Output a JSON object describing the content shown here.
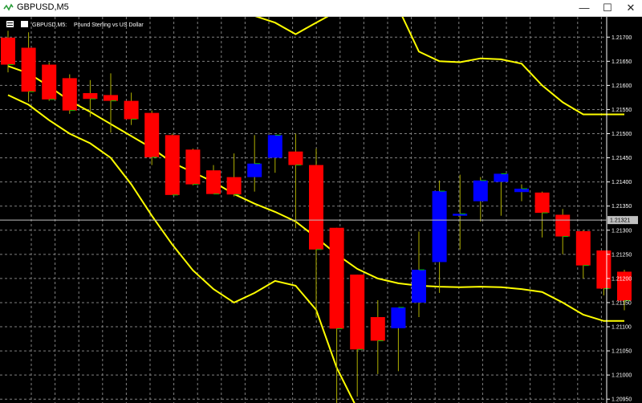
{
  "window": {
    "title": "GBPUSD,M5",
    "minimize_glyph": "—",
    "maximize_glyph": "☐",
    "close_glyph": "✕"
  },
  "chart_header": {
    "symbol_text": "GBPUSD,M5:",
    "description": "Pound Sterling vs US Dollar"
  },
  "colors": {
    "background": "#000000",
    "grid": "#808080",
    "bull": "#0000ff",
    "bear": "#ff0000",
    "bands": "#ffff00",
    "axis_text": "#ffffff",
    "current_price_tag": "#c0c0c0"
  },
  "current_price": "1.21321",
  "chart_data": {
    "type": "candlestick",
    "y_axis_ticks": [
      "1.21700",
      "1.21650",
      "1.21600",
      "1.21550",
      "1.21500",
      "1.21450",
      "1.21400",
      "1.21350",
      "1.21300",
      "1.21250",
      "1.21200",
      "1.21150",
      "1.21100",
      "1.21050",
      "1.21000",
      "1.20950"
    ],
    "ylim": [
      1.20942,
      1.21742
    ],
    "candles": [
      {
        "o": 1.21699,
        "h": 1.21713,
        "l": 1.21627,
        "c": 1.21643
      },
      {
        "o": 1.21678,
        "h": 1.2171,
        "l": 1.21566,
        "c": 1.21587
      },
      {
        "o": 1.21643,
        "h": 1.21648,
        "l": 1.21568,
        "c": 1.21571
      },
      {
        "o": 1.21615,
        "h": 1.21623,
        "l": 1.21541,
        "c": 1.21548
      },
      {
        "o": 1.21584,
        "h": 1.21611,
        "l": 1.21535,
        "c": 1.21572
      },
      {
        "o": 1.2158,
        "h": 1.21625,
        "l": 1.21502,
        "c": 1.21568
      },
      {
        "o": 1.21568,
        "h": 1.21585,
        "l": 1.21518,
        "c": 1.2153
      },
      {
        "o": 1.21543,
        "h": 1.21548,
        "l": 1.21435,
        "c": 1.21451
      },
      {
        "o": 1.21497,
        "h": 1.215,
        "l": 1.21375,
        "c": 1.21373
      },
      {
        "o": 1.21467,
        "h": 1.21469,
        "l": 1.21393,
        "c": 1.21395
      },
      {
        "o": 1.21424,
        "h": 1.21435,
        "l": 1.2138,
        "c": 1.21375
      },
      {
        "o": 1.2141,
        "h": 1.21459,
        "l": 1.2137,
        "c": 1.21374
      },
      {
        "o": 1.2141,
        "h": 1.21497,
        "l": 1.2138,
        "c": 1.21438
      },
      {
        "o": 1.2145,
        "h": 1.21484,
        "l": 1.21419,
        "c": 1.21497
      },
      {
        "o": 1.21463,
        "h": 1.215,
        "l": 1.21304,
        "c": 1.21435
      },
      {
        "o": 1.21435,
        "h": 1.21469,
        "l": 1.2112,
        "c": 1.2126
      },
      {
        "o": 1.21305,
        "h": 1.21305,
        "l": 1.2094,
        "c": 1.21096
      },
      {
        "o": 1.21208,
        "h": 1.21208,
        "l": 1.20955,
        "c": 1.21053
      },
      {
        "o": 1.2112,
        "h": 1.21155,
        "l": 1.21002,
        "c": 1.21071
      },
      {
        "o": 1.21097,
        "h": 1.2112,
        "l": 1.21008,
        "c": 1.2114
      },
      {
        "o": 1.2115,
        "h": 1.21297,
        "l": 1.2112,
        "c": 1.21218
      },
      {
        "o": 1.21234,
        "h": 1.21403,
        "l": 1.2117,
        "c": 1.21381
      },
      {
        "o": 1.2133,
        "h": 1.21415,
        "l": 1.2126,
        "c": 1.21334
      },
      {
        "o": 1.2136,
        "h": 1.2141,
        "l": 1.21318,
        "c": 1.21403
      },
      {
        "o": 1.214,
        "h": 1.21406,
        "l": 1.2133,
        "c": 1.21417
      },
      {
        "o": 1.21379,
        "h": 1.21395,
        "l": 1.2136,
        "c": 1.21386
      },
      {
        "o": 1.21378,
        "h": 1.2138,
        "l": 1.21285,
        "c": 1.21336
      },
      {
        "o": 1.21332,
        "h": 1.21344,
        "l": 1.2125,
        "c": 1.21287
      },
      {
        "o": 1.21298,
        "h": 1.213,
        "l": 1.212,
        "c": 1.21227
      },
      {
        "o": 1.21258,
        "h": 1.21258,
        "l": 1.21165,
        "c": 1.21179
      },
      {
        "o": 1.21214,
        "h": 1.21218,
        "l": 1.21134,
        "c": 1.21154
      }
    ],
    "bollinger": {
      "upper": [
        null,
        null,
        null,
        null,
        null,
        null,
        null,
        null,
        null,
        null,
        null,
        null,
        1.21744,
        1.2173,
        1.21706,
        1.2173,
        1.21753,
        1.2179,
        1.2181,
        1.2176,
        1.2167,
        1.2165,
        1.21648,
        1.21656,
        1.21654,
        1.21645,
        1.216,
        1.21565,
        1.2154,
        1.2154,
        1.2154
      ],
      "middle": [
        1.2164,
        1.21625,
        1.21598,
        1.21568,
        1.21545,
        1.2152,
        1.21495,
        1.2147,
        1.2144,
        1.2142,
        1.214,
        1.21375,
        1.21355,
        1.21338,
        1.21318,
        1.21285,
        1.2125,
        1.2122,
        1.212,
        1.2119,
        1.21185,
        1.21183,
        1.21182,
        1.21183,
        1.21182,
        1.21178,
        1.21172,
        1.2115,
        1.21125,
        1.21112,
        1.21112
      ],
      "lower": [
        1.2158,
        1.2156,
        1.21528,
        1.215,
        1.2148,
        1.2145,
        1.21395,
        1.2133,
        1.2127,
        1.21217,
        1.21178,
        1.2115,
        1.2117,
        1.21195,
        1.21185,
        1.21135,
        1.21015,
        1.2093,
        null,
        null,
        null,
        null,
        null,
        null,
        null,
        null,
        null,
        null,
        null,
        null,
        null
      ]
    }
  }
}
